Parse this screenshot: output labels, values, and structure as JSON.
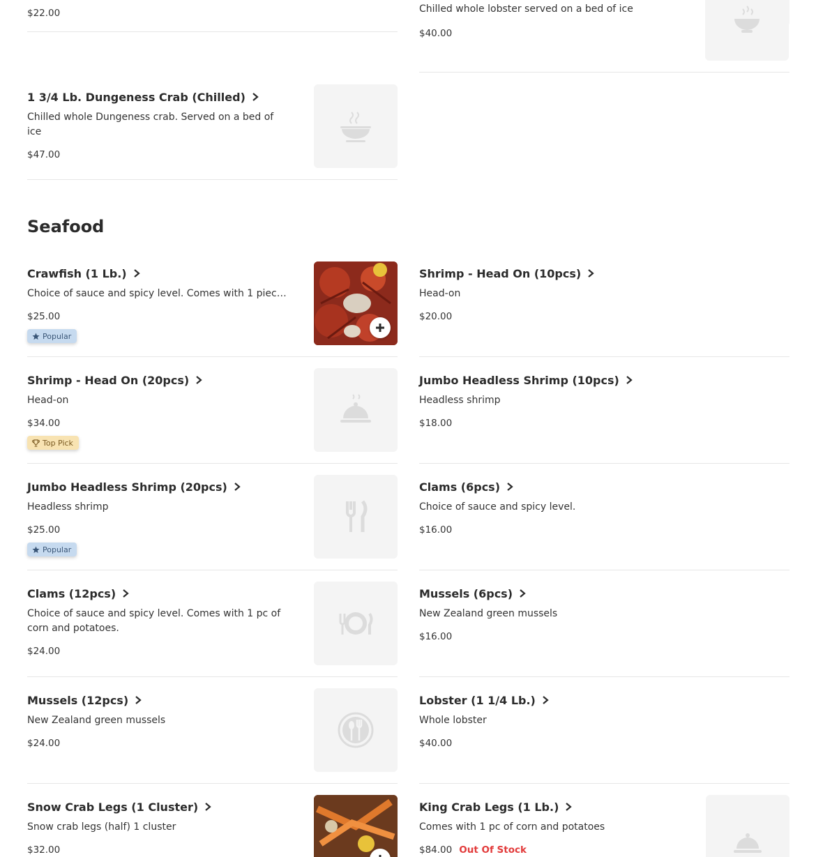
{
  "top_partial": {
    "left": {
      "price": "$22.00"
    },
    "right": {
      "desc": "Chilled whole lobster served on a bed of ice",
      "price": "$40.00"
    }
  },
  "dungeness": {
    "name": "1 3/4 Lb. Dungeness Crab (Chilled)",
    "desc": "Chilled whole Dungeness crab. Served on a bed of ice",
    "price": "$47.00"
  },
  "section": {
    "title": "Seafood"
  },
  "items": [
    {
      "name": "Crawfish (1 Lb.)",
      "desc": "Choice of sauce and spicy level. Comes with 1 piece...",
      "price": "$25.00",
      "badge": "Popular"
    },
    {
      "name": "Shrimp - Head On (10pcs)",
      "desc": "Head-on",
      "price": "$20.00"
    },
    {
      "name": "Shrimp - Head On (20pcs)",
      "desc": "Head-on",
      "price": "$34.00",
      "badge": "Top Pick"
    },
    {
      "name": "Jumbo Headless Shrimp (10pcs)",
      "desc": "Headless shrimp",
      "price": "$18.00"
    },
    {
      "name": "Jumbo Headless Shrimp (20pcs)",
      "desc": "Headless shrimp",
      "price": "$25.00",
      "badge": "Popular"
    },
    {
      "name": "Clams (6pcs)",
      "desc": "Choice of sauce and spicy level.",
      "price": "$16.00"
    },
    {
      "name": "Clams (12pcs)",
      "desc": "Choice of sauce and spicy level. Comes with 1 pc of corn and potatoes.",
      "price": "$24.00"
    },
    {
      "name": "Mussels (6pcs)",
      "desc": "New Zealand green mussels",
      "price": "$16.00"
    },
    {
      "name": "Mussels (12pcs)",
      "desc": "New Zealand green mussels",
      "price": "$24.00"
    },
    {
      "name": "Lobster (1 1/4 Lb.)",
      "desc": "Whole lobster",
      "price": "$40.00"
    },
    {
      "name": "Snow Crab Legs (1 Cluster)",
      "desc": "Snow crab legs (half) 1 cluster",
      "price": "$32.00"
    },
    {
      "name": "King Crab Legs (1 Lb.)",
      "desc": "Comes with 1 pc of corn and potatoes",
      "price": "$84.00",
      "status": "Out Of Stock"
    }
  ],
  "colors": {
    "out_of_stock": "#e23b3b",
    "popular_badge": "#c6daef",
    "toppick_badge": "#f8e3b2",
    "placeholder_bg": "#f4f4f4"
  }
}
